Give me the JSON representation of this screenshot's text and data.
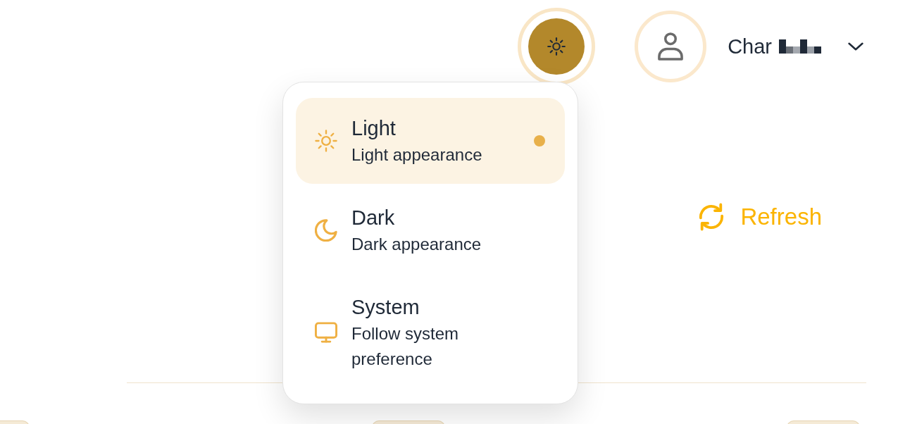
{
  "header": {
    "user": {
      "name": "Char"
    }
  },
  "theme_menu": {
    "options": [
      {
        "kind": "light",
        "title": "Light",
        "subtitle": "Light appearance",
        "selected": true
      },
      {
        "kind": "dark",
        "title": "Dark",
        "subtitle": "Dark appearance",
        "selected": false
      },
      {
        "kind": "system",
        "title": "System",
        "subtitle": "Follow system preference",
        "selected": false
      }
    ]
  },
  "toolbar": {
    "refresh_button": {
      "label": "Refresh"
    }
  }
}
